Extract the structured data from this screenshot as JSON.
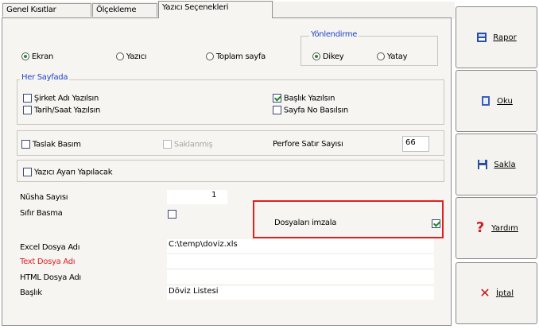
{
  "tabs": [
    {
      "label": "Genel Kısıtlar"
    },
    {
      "label": "Ölçekleme"
    },
    {
      "label": "Yazıcı Seçenekleri"
    }
  ],
  "output": {
    "ekran": "Ekran",
    "yazici": "Yazıcı",
    "toplam": "Toplam sayfa"
  },
  "orientation": {
    "title": "Yönlendirme",
    "dikey": "Dikey",
    "yatay": "Yatay"
  },
  "her_sayfada": {
    "title": "Her Sayfada",
    "sirket": "Şirket Adı Yazılsın",
    "tarih": "Tarih/Saat Yazılsın",
    "baslik": "Başlık Yazılsın",
    "sayfa_no": "Sayfa No Basılsın"
  },
  "taslak": "Taslak Basım",
  "saklanmis": "Saklanmış",
  "perfore": {
    "label": "Perfore Satır Sayısı",
    "value": "66"
  },
  "yazici_ayari": "Yazıcı Ayarı Yapılacak",
  "form": {
    "nusha_label": "Nüsha Sayısı",
    "nusha_value": "1",
    "sifir_label": "Sıfır Basma",
    "dosyalari_label": "Dosyaları imzala",
    "excel_label": "Excel Dosya Adı",
    "excel_value": "C:\\temp\\doviz.xls",
    "text_label": "Text Dosya Adı",
    "text_value": "",
    "html_label": "HTML Dosya Adı",
    "html_value": "",
    "baslik_label": "Başlık",
    "baslik_value": "Döviz Listesi"
  },
  "buttons": {
    "rapor": "Rapor",
    "oku": "Oku",
    "sakla": "Sakla",
    "yardim": "Yardım",
    "iptal": "İptal"
  },
  "colors": {
    "text_red": "#e02020",
    "highlight": "#e02020",
    "check_green": "#1f8a1f",
    "group_blue": "#2244cc"
  }
}
